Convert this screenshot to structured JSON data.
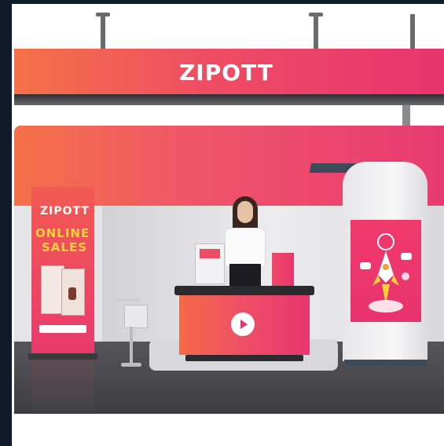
{
  "booth": {
    "header_sign": "ZIPOTT"
  },
  "banner": {
    "brand": "ZIPOTT",
    "headline_line1": "ONLINE",
    "headline_line2": "SALES"
  },
  "counter": {
    "video_icon": "play-icon"
  },
  "colors": {
    "brand_gradient_start": "#f26a45",
    "brand_gradient_end": "#e8336f",
    "headline_yellow": "#ffd23a",
    "floor": "#4a4a4d",
    "background_frame": "#0d1b2a"
  }
}
